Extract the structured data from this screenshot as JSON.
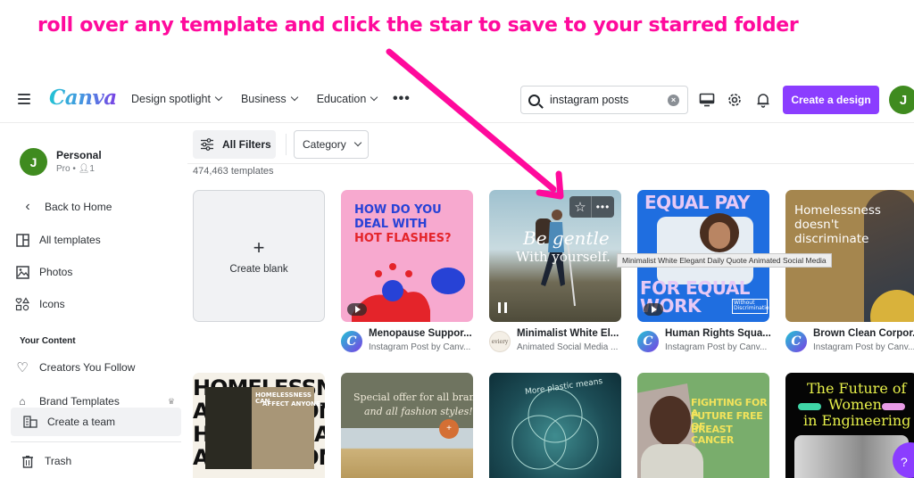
{
  "annotation": {
    "text": "roll over any template and click the star to save to your starred folder",
    "color": "#ff0a9c"
  },
  "header": {
    "menu_icon": "hamburger-icon",
    "logo": "Canva",
    "nav": [
      {
        "label": "Design spotlight"
      },
      {
        "label": "Business"
      },
      {
        "label": "Education"
      }
    ],
    "more_label": "•••",
    "search": {
      "value": "instagram posts",
      "placeholder": "Search"
    },
    "icons": [
      "desktop-icon",
      "gear-icon",
      "bell-icon"
    ],
    "create_label": "Create a design",
    "avatar_initial": "J",
    "accent_color": "#8b3dff"
  },
  "sidebar": {
    "account": {
      "initial": "J",
      "name": "Personal",
      "plan": "Pro",
      "members": "1"
    },
    "back_label": "Back to Home",
    "items": [
      {
        "label": "All templates",
        "icon": "templates-icon"
      },
      {
        "label": "Photos",
        "icon": "photo-icon"
      },
      {
        "label": "Icons",
        "icon": "shapes-icon"
      }
    ],
    "section_heading": "Your Content",
    "content_items": [
      {
        "label": "Creators You Follow",
        "icon": "heart-icon"
      },
      {
        "label": "Brand Templates",
        "icon": "brand-icon"
      }
    ],
    "create_team_label": "Create a team",
    "trash_label": "Trash"
  },
  "filters": {
    "all_filters_label": "All Filters",
    "category_label": "Category",
    "count_text": "474,463 templates"
  },
  "grid": {
    "create_blank_label": "Create blank",
    "row1": [
      {
        "thumb_lines": [
          "HOW DO YOU",
          "DEAL WITH",
          "HOT FLASHES?"
        ],
        "title": "Menopause Suppor...",
        "subtitle": "Instagram Post by Canv...",
        "avatar": "C",
        "media": "play"
      },
      {
        "thumb_lines": [
          "Be gentle",
          "With yourself."
        ],
        "title": "Minimalist White El...",
        "subtitle": "Animated Social Media ...",
        "avatar": "eviery",
        "media": "pause",
        "hovered": true
      },
      {
        "thumb_lines": [
          "EQUAL PAY",
          "FOR EQUAL",
          "WORK",
          "Without Discrimination"
        ],
        "title": "Human Rights Squa...",
        "subtitle": "Instagram Post by Canv...",
        "avatar": "C",
        "media": "play"
      },
      {
        "thumb_lines": [
          "Homelessness",
          "doesn't",
          "discriminate"
        ],
        "title": "Brown Clean Corpor...",
        "subtitle": "Instagram Post by Canv...",
        "avatar": "C",
        "media": "none"
      }
    ],
    "row2": [
      {
        "thumb_lines": [
          "HOMELESSNESS CAN",
          "AFFECT ANYONE."
        ]
      },
      {
        "thumb_lines": [
          "Special offer for all brands",
          "and all fashion styles!"
        ]
      },
      {
        "thumb_lines": [
          "More plastic means"
        ]
      },
      {
        "thumb_lines": [
          "FIGHTING FOR A",
          "FUTURE FREE OF",
          "BREAST CANCER"
        ]
      },
      {
        "thumb_lines": [
          "The Future of",
          "Women",
          "in Engineering"
        ]
      }
    ],
    "tooltip": "Minimalist White Elegant Daily Quote Animated Social Media",
    "star_icon": "star-icon",
    "more_icon": "more-icon"
  },
  "help_label": "?"
}
